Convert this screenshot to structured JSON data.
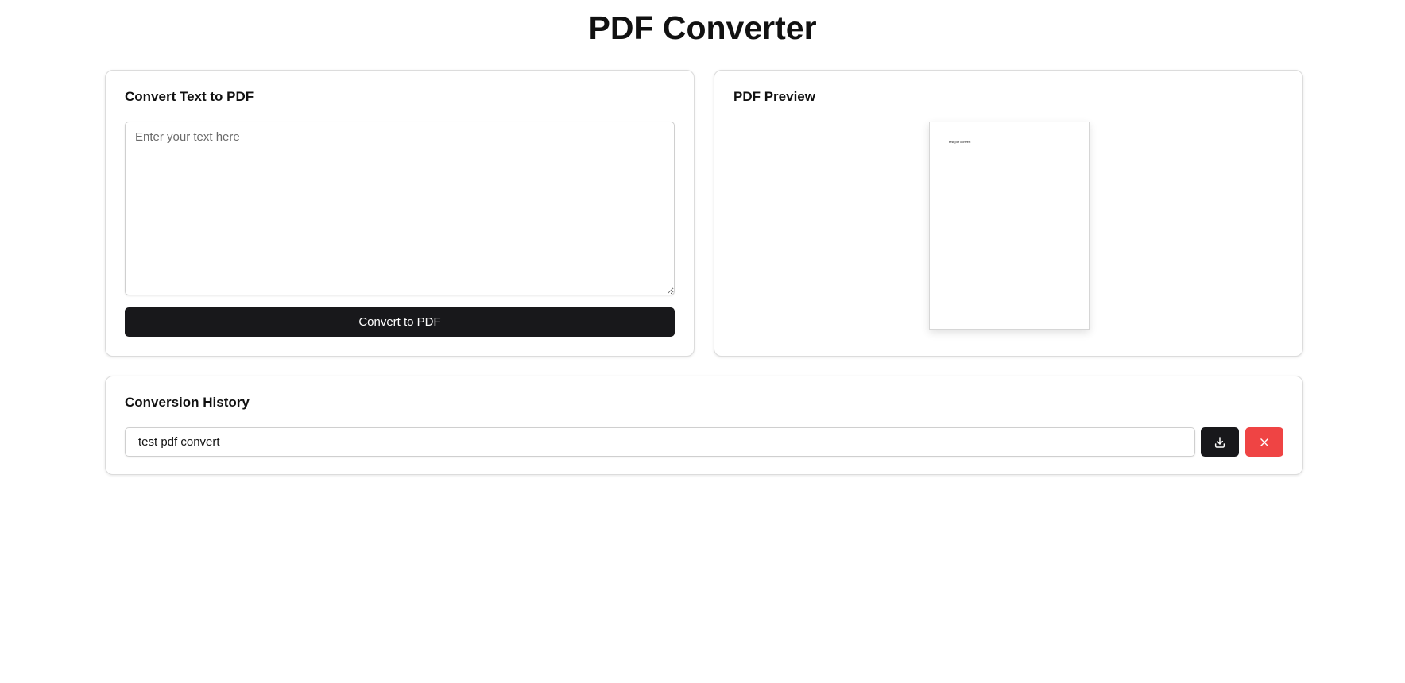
{
  "app": {
    "title": "PDF Converter"
  },
  "convert_panel": {
    "title": "Convert Text to PDF",
    "input_value": "",
    "input_placeholder": "Enter your text here",
    "button_label": "Convert to PDF"
  },
  "preview_panel": {
    "title": "PDF Preview",
    "page_text": "test pdf convert"
  },
  "history_panel": {
    "title": "Conversion History",
    "items": [
      {
        "name": "test pdf convert",
        "download_icon": "download-icon",
        "delete_icon": "close-icon"
      }
    ]
  },
  "colors": {
    "primary_button": "#18181b",
    "danger_button": "#ef4444",
    "border": "#dcdcdc"
  }
}
